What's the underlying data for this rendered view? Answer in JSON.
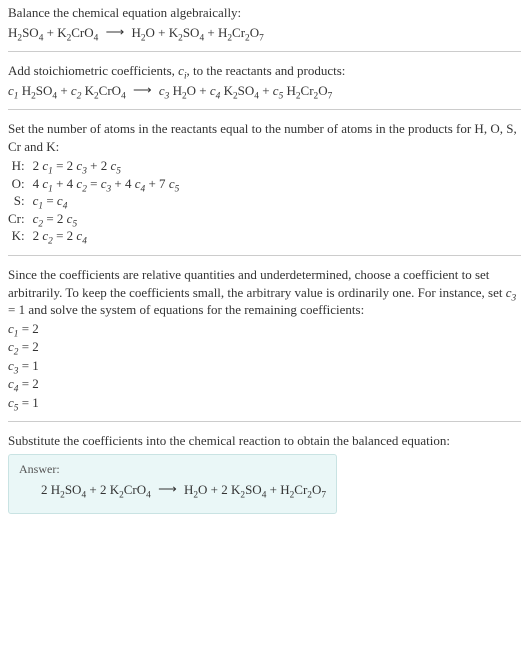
{
  "step1": {
    "text": "Balance the chemical equation algebraically:",
    "eq_a1": "H",
    "eq_a1s": "2",
    "eq_a2": "SO",
    "eq_a2s": "4",
    "plus1": " + ",
    "eq_b1": "K",
    "eq_b1s": "2",
    "eq_b2": "CrO",
    "eq_b2s": "4",
    "arrow": "⟶",
    "eq_c1": "H",
    "eq_c1s": "2",
    "eq_c2": "O",
    "plus2": " + ",
    "eq_d1": "K",
    "eq_d1s": "2",
    "eq_d2": "SO",
    "eq_d2s": "4",
    "plus3": " + ",
    "eq_e1": "H",
    "eq_e1s": "2",
    "eq_e2": "Cr",
    "eq_e2s": "2",
    "eq_e3": "O",
    "eq_e3s": "7"
  },
  "step2": {
    "text_a": "Add stoichiometric coefficients, ",
    "ci": "c",
    "ci_sub": "i",
    "text_b": ", to the reactants and products:",
    "c1": "c",
    "c1s": "1",
    "sp_a1": " H",
    "sp_a1s": "2",
    "sp_a2": "SO",
    "sp_a2s": "4",
    "plus1": " + ",
    "c2": "c",
    "c2s": "2",
    "sp_b1": " K",
    "sp_b1s": "2",
    "sp_b2": "CrO",
    "sp_b2s": "4",
    "arrow": "⟶",
    "c3": "c",
    "c3s": "3",
    "sp_c1": " H",
    "sp_c1s": "2",
    "sp_c2": "O",
    "plus2": " + ",
    "c4": "c",
    "c4s": "4",
    "sp_d1": " K",
    "sp_d1s": "2",
    "sp_d2": "SO",
    "sp_d2s": "4",
    "plus3": " + ",
    "c5": "c",
    "c5s": "5",
    "sp_e1": " H",
    "sp_e1s": "2",
    "sp_e2": "Cr",
    "sp_e2s": "2",
    "sp_e3": "O",
    "sp_e3s": "7"
  },
  "step3": {
    "text": "Set the number of atoms in the reactants equal to the number of atoms in the products for H, O, S, Cr and K:",
    "rows": {
      "H_l": "H:",
      "H_a": "2 ",
      "H_c1": "c",
      "H_c1s": "1",
      "H_b": " = 2 ",
      "H_c3": "c",
      "H_c3s": "3",
      "H_c": " + 2 ",
      "H_c5": "c",
      "H_c5s": "5",
      "O_l": "O:",
      "O_a": "4 ",
      "O_c1": "c",
      "O_c1s": "1",
      "O_b": " + 4 ",
      "O_c2": "c",
      "O_c2s": "2",
      "O_c": " = ",
      "O_c3": "c",
      "O_c3s": "3",
      "O_d": " + 4 ",
      "O_c4": "c",
      "O_c4s": "4",
      "O_e": " + 7 ",
      "O_c5": "c",
      "O_c5s": "5",
      "S_l": "S:",
      "S_c1": "c",
      "S_c1s": "1",
      "S_a": " = ",
      "S_c4": "c",
      "S_c4s": "4",
      "Cr_l": "Cr:",
      "Cr_c2": "c",
      "Cr_c2s": "2",
      "Cr_a": " = 2 ",
      "Cr_c5": "c",
      "Cr_c5s": "5",
      "K_l": "K:",
      "K_a": "2 ",
      "K_c2": "c",
      "K_c2s": "2",
      "K_b": " = 2 ",
      "K_c4": "c",
      "K_c4s": "4"
    }
  },
  "step4": {
    "text_a": "Since the coefficients are relative quantities and underdetermined, choose a coefficient to set arbitrarily. To keep the coefficients small, the arbitrary value is ordinarily one. For instance, set ",
    "c3": "c",
    "c3s": "3",
    "text_b": " = 1 and solve the system of equations for the remaining coefficients:",
    "l1a": "c",
    "l1as": "1",
    "l1b": " = 2",
    "l2a": "c",
    "l2as": "2",
    "l2b": " = 2",
    "l3a": "c",
    "l3as": "3",
    "l3b": " = 1",
    "l4a": "c",
    "l4as": "4",
    "l4b": " = 2",
    "l5a": "c",
    "l5as": "5",
    "l5b": " = 1"
  },
  "step5": {
    "text": "Substitute the coefficients into the chemical reaction to obtain the balanced equation:",
    "answer_label": "Answer:",
    "n1": "2 ",
    "a1": "H",
    "a1s": "2",
    "a2": "SO",
    "a2s": "4",
    "plus1": " + ",
    "n2": "2 ",
    "b1": "K",
    "b1s": "2",
    "b2": "CrO",
    "b2s": "4",
    "arrow": "⟶",
    "c1": "H",
    "c1s": "2",
    "c2": "O",
    "plus2": " + ",
    "n3": "2 ",
    "d1": "K",
    "d1s": "2",
    "d2": "SO",
    "d2s": "4",
    "plus3": " + ",
    "e1": "H",
    "e1s": "2",
    "e2": "Cr",
    "e2s": "2",
    "e3": "O",
    "e3s": "7"
  }
}
